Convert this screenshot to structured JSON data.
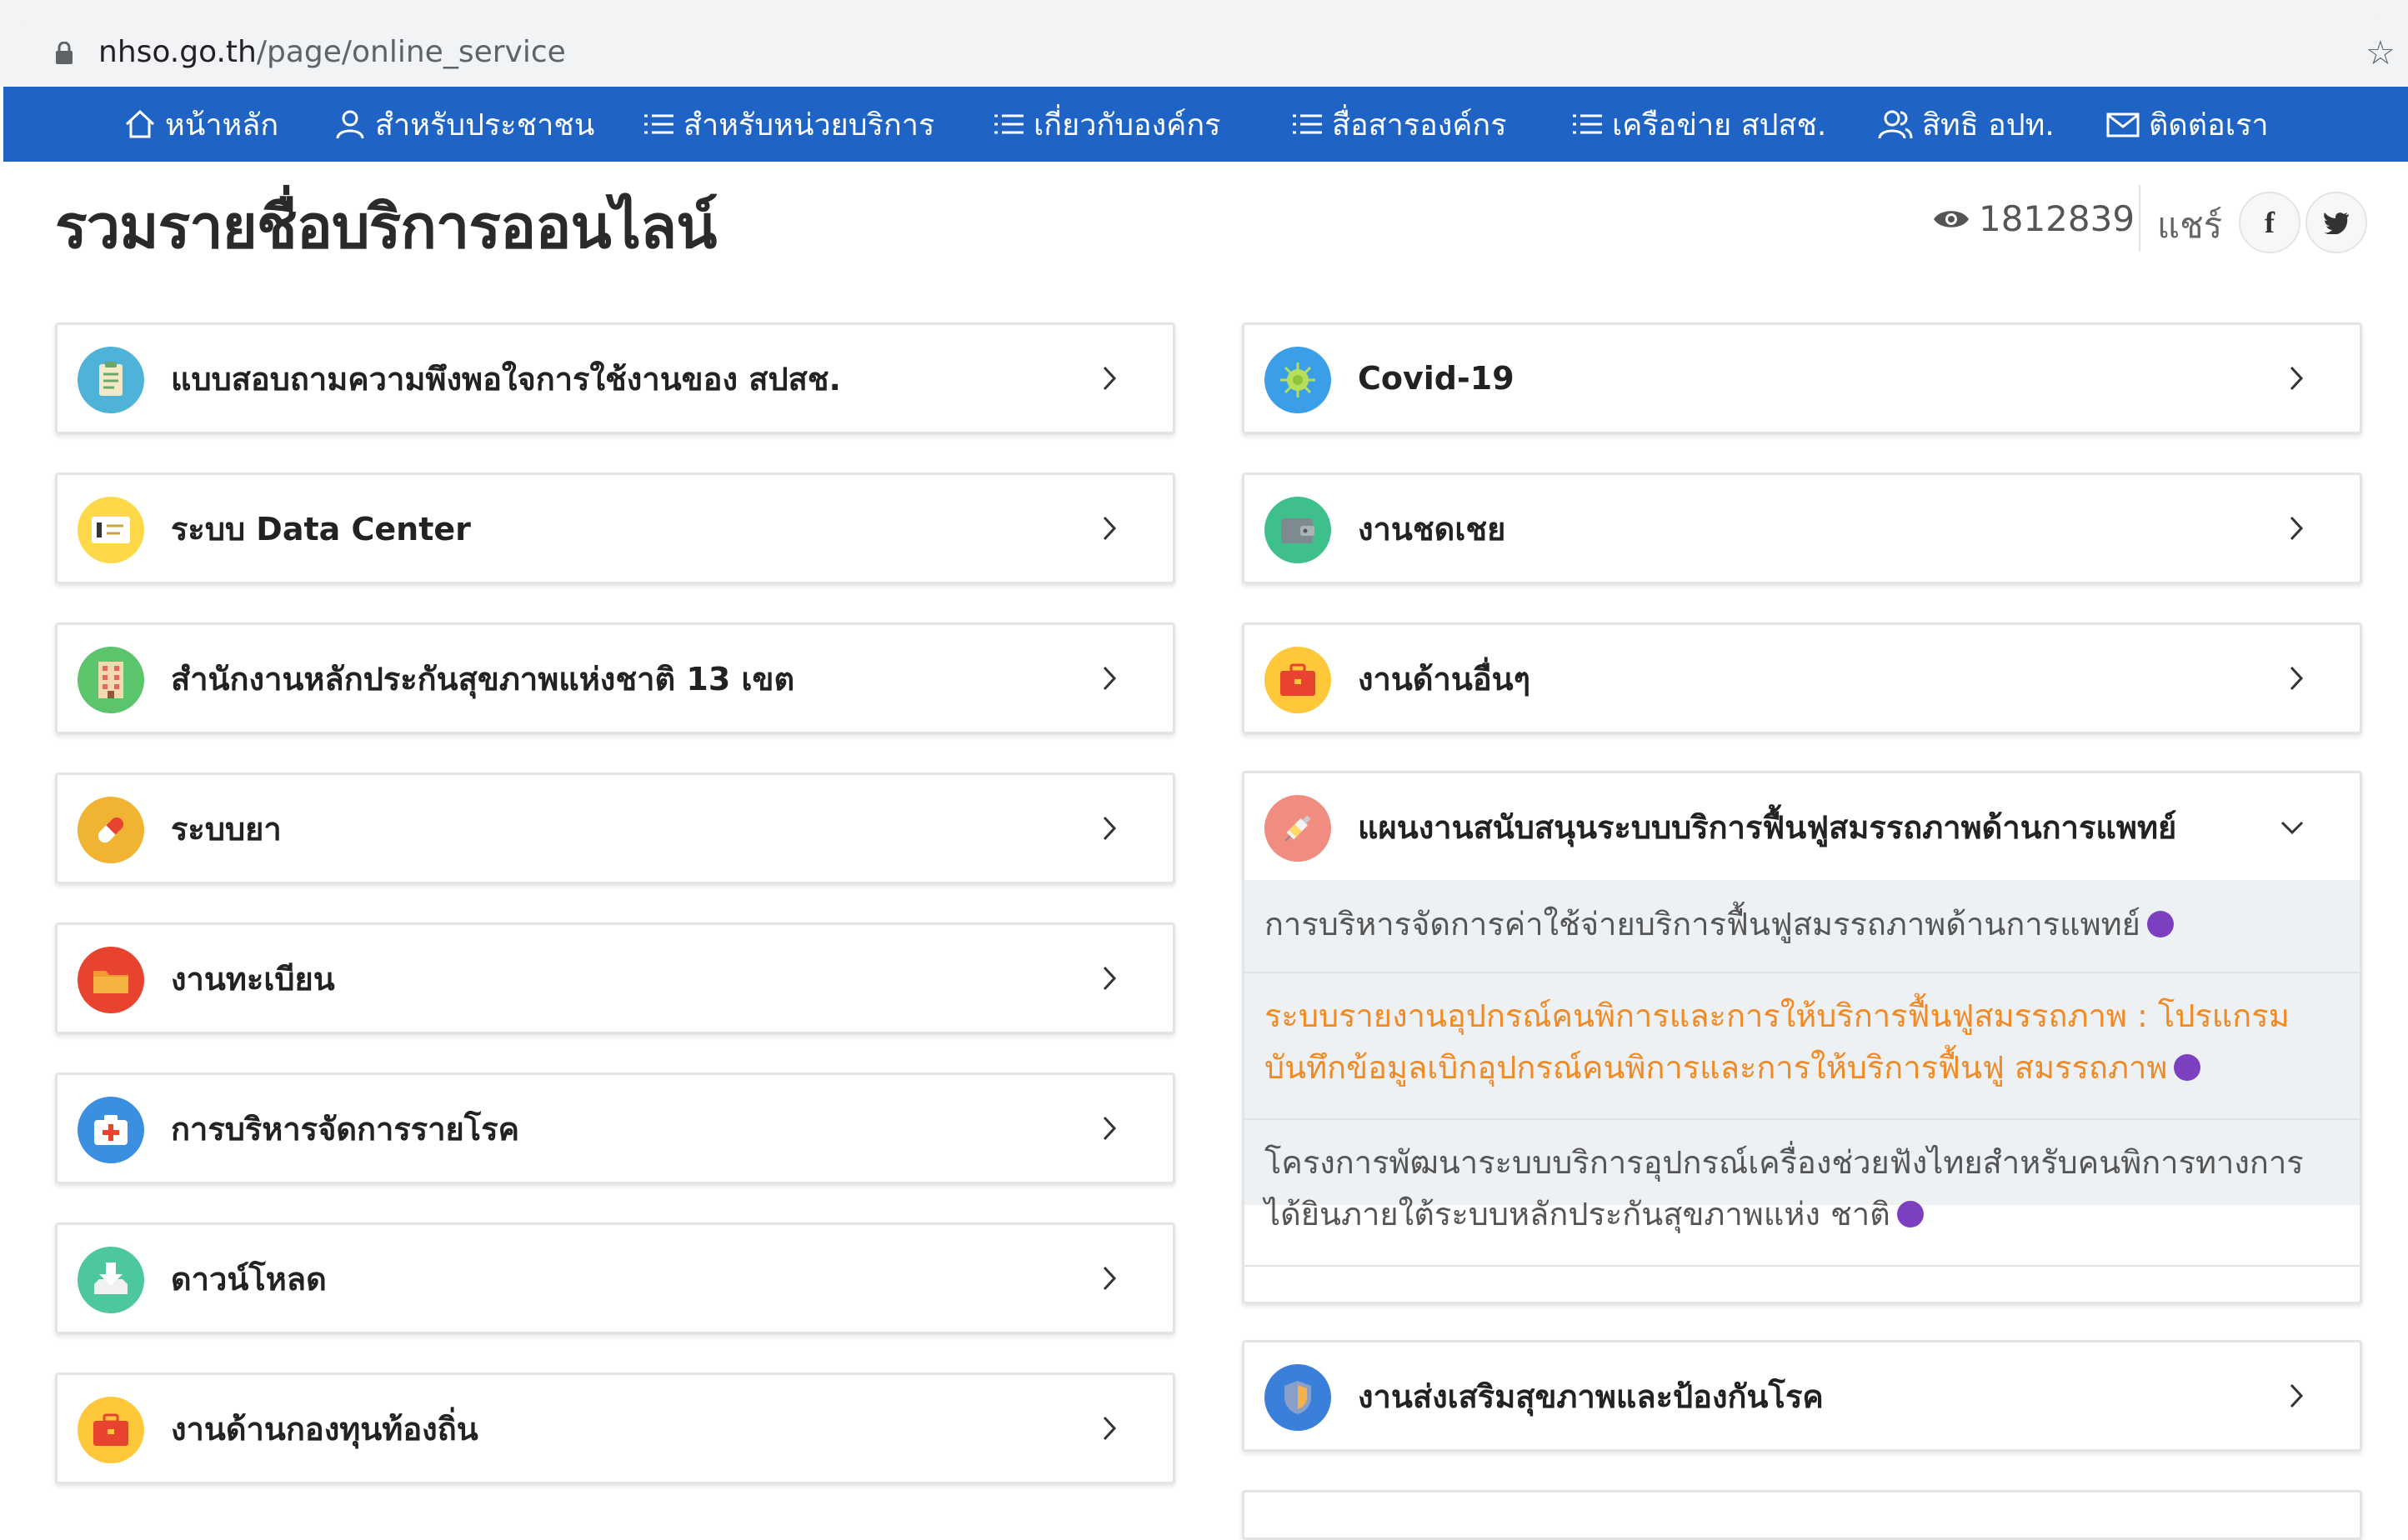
{
  "browser": {
    "url_domain": "nhso.go.th",
    "url_path": "/page/online_service"
  },
  "nav": [
    {
      "label": "หน้าหลัก",
      "icon": "home-icon"
    },
    {
      "label": "สำหรับประชาชน",
      "icon": "user-icon"
    },
    {
      "label": "สำหรับหน่วยบริการ",
      "icon": "list-icon"
    },
    {
      "label": "เกี่ยวกับองค์กร",
      "icon": "list-icon"
    },
    {
      "label": "สื่อสารองค์กร",
      "icon": "list-icon"
    },
    {
      "label": "เครือข่าย สปสช.",
      "icon": "list-icon"
    },
    {
      "label": "สิทธิ อปท.",
      "icon": "users-icon"
    },
    {
      "label": "ติดต่อเรา",
      "icon": "mail-icon"
    }
  ],
  "page": {
    "title": "รวมรายชื่อบริการออนไลน์",
    "views": "1812839",
    "share_label": "แชร์"
  },
  "left_cards": [
    {
      "label": "แบบสอบถามความพึงพอใจการใช้งานของ สปสช.",
      "icon": "survey-icon",
      "color": "#4fb3d9"
    },
    {
      "label": "ระบบ Data Center",
      "icon": "id-card-icon",
      "color": "#ffd84a"
    },
    {
      "label": "สำนักงานหลักประกันสุขภาพแห่งชาติ 13 เขต",
      "icon": "building-icon",
      "color": "#5cc46a"
    },
    {
      "label": "ระบบยา",
      "icon": "medicine-icon",
      "color": "#f0b432"
    },
    {
      "label": "งานทะเบียน",
      "icon": "folder-icon",
      "color": "#e8432e"
    },
    {
      "label": "การบริหารจัดการรายโรค",
      "icon": "first-aid-icon",
      "color": "#3a8fe0"
    },
    {
      "label": "ดาวน์โหลด",
      "icon": "download-icon",
      "color": "#4cc7a0"
    },
    {
      "label": "งานด้านกองทุนท้องถิ่น",
      "icon": "briefcase-icon",
      "color": "#ffc83a"
    }
  ],
  "right_cards": [
    {
      "label": "Covid-19",
      "icon": "virus-icon",
      "color": "#3a9fe8"
    },
    {
      "label": "งานชดเชย",
      "icon": "wallet-icon",
      "color": "#3fbf8c"
    },
    {
      "label": "งานด้านอื่นๆ",
      "icon": "briefcase-icon",
      "color": "#ffc83a"
    }
  ],
  "expanded": {
    "label": "แผนงานสนับสนุนระบบบริการฟื้นฟูสมรรถภาพด้านการแพทย์",
    "icon": "syringe-icon",
    "color": "#f08c80",
    "items": [
      {
        "text": "การบริหารจัดการค่าใช้จ่ายบริการฟื้นฟูสมรรถภาพด้านการแพทย์",
        "highlight": false
      },
      {
        "text": "ระบบรายงานอุปกรณ์คนพิการและการให้บริการฟื้นฟูสมรรถภาพ : โปรแกรมบันทึกข้อมูลเบิกอุปกรณ์คนพิการและการให้บริการฟื้นฟู สมรรถภาพ",
        "highlight": true
      },
      {
        "text": "โครงการพัฒนาระบบบริการอุปกรณ์เครื่องช่วยฟังไทยสำหรับคนพิการทางการได้ยินภายใต้ระบบหลักประกันสุขภาพแห่ง ชาติ",
        "highlight": false
      }
    ]
  },
  "bottom_right_card": {
    "label": "งานส่งเสริมสุขภาพและป้องกันโรค",
    "icon": "shield-icon",
    "color": "#3a7fd9"
  }
}
